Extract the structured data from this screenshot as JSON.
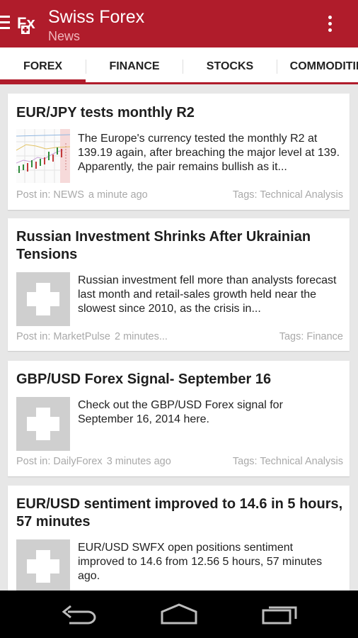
{
  "app": {
    "title": "Swiss Forex",
    "subtitle": "News",
    "logo_text": "Fx"
  },
  "tabs": [
    {
      "label": "FOREX",
      "active": true
    },
    {
      "label": "FINANCE",
      "active": false
    },
    {
      "label": "STOCKS",
      "active": false
    },
    {
      "label": "COMMODITIES",
      "active": false
    }
  ],
  "articles": [
    {
      "title": "EUR/JPY tests monthly R2",
      "summary": "The Europe's currency tested the monthly R2 at 139.19 again, after breaching the major level at 139. Apparently, the pair remains bullish as it...",
      "post_in": "Post in: NEWS",
      "time": "a minute ago",
      "tags": "Tags: Technical Analysis",
      "thumbnail": "chart"
    },
    {
      "title": "Russian Investment Shrinks After Ukrainian Tensions",
      "summary": "Russian investment fell more than analysts forecast last month and retail-sales growth held near the slowest since 2010, as the crisis in...",
      "post_in": "Post in: MarketPulse",
      "time": "2 minutes...",
      "tags": "Tags: Finance",
      "thumbnail": "placeholder"
    },
    {
      "title": "GBP/USD Forex Signal- September 16",
      "summary": "Check out the GBP/USD Forex signal for September 16, 2014 here.",
      "post_in": "Post in: DailyForex",
      "time": "3 minutes ago",
      "tags": "Tags: Technical Analysis",
      "thumbnail": "placeholder"
    },
    {
      "title": "EUR/USD sentiment improved to 14.6 in 5 hours, 57 minutes",
      "summary": "EUR/USD SWFX open positions sentiment improved to 14.6 from 12.56 5 hours, 57 minutes ago.",
      "thumbnail": "placeholder"
    }
  ],
  "colors": {
    "primary": "#b01c2b",
    "background": "#e7e7e7",
    "meta_text": "#a9a9a9"
  }
}
